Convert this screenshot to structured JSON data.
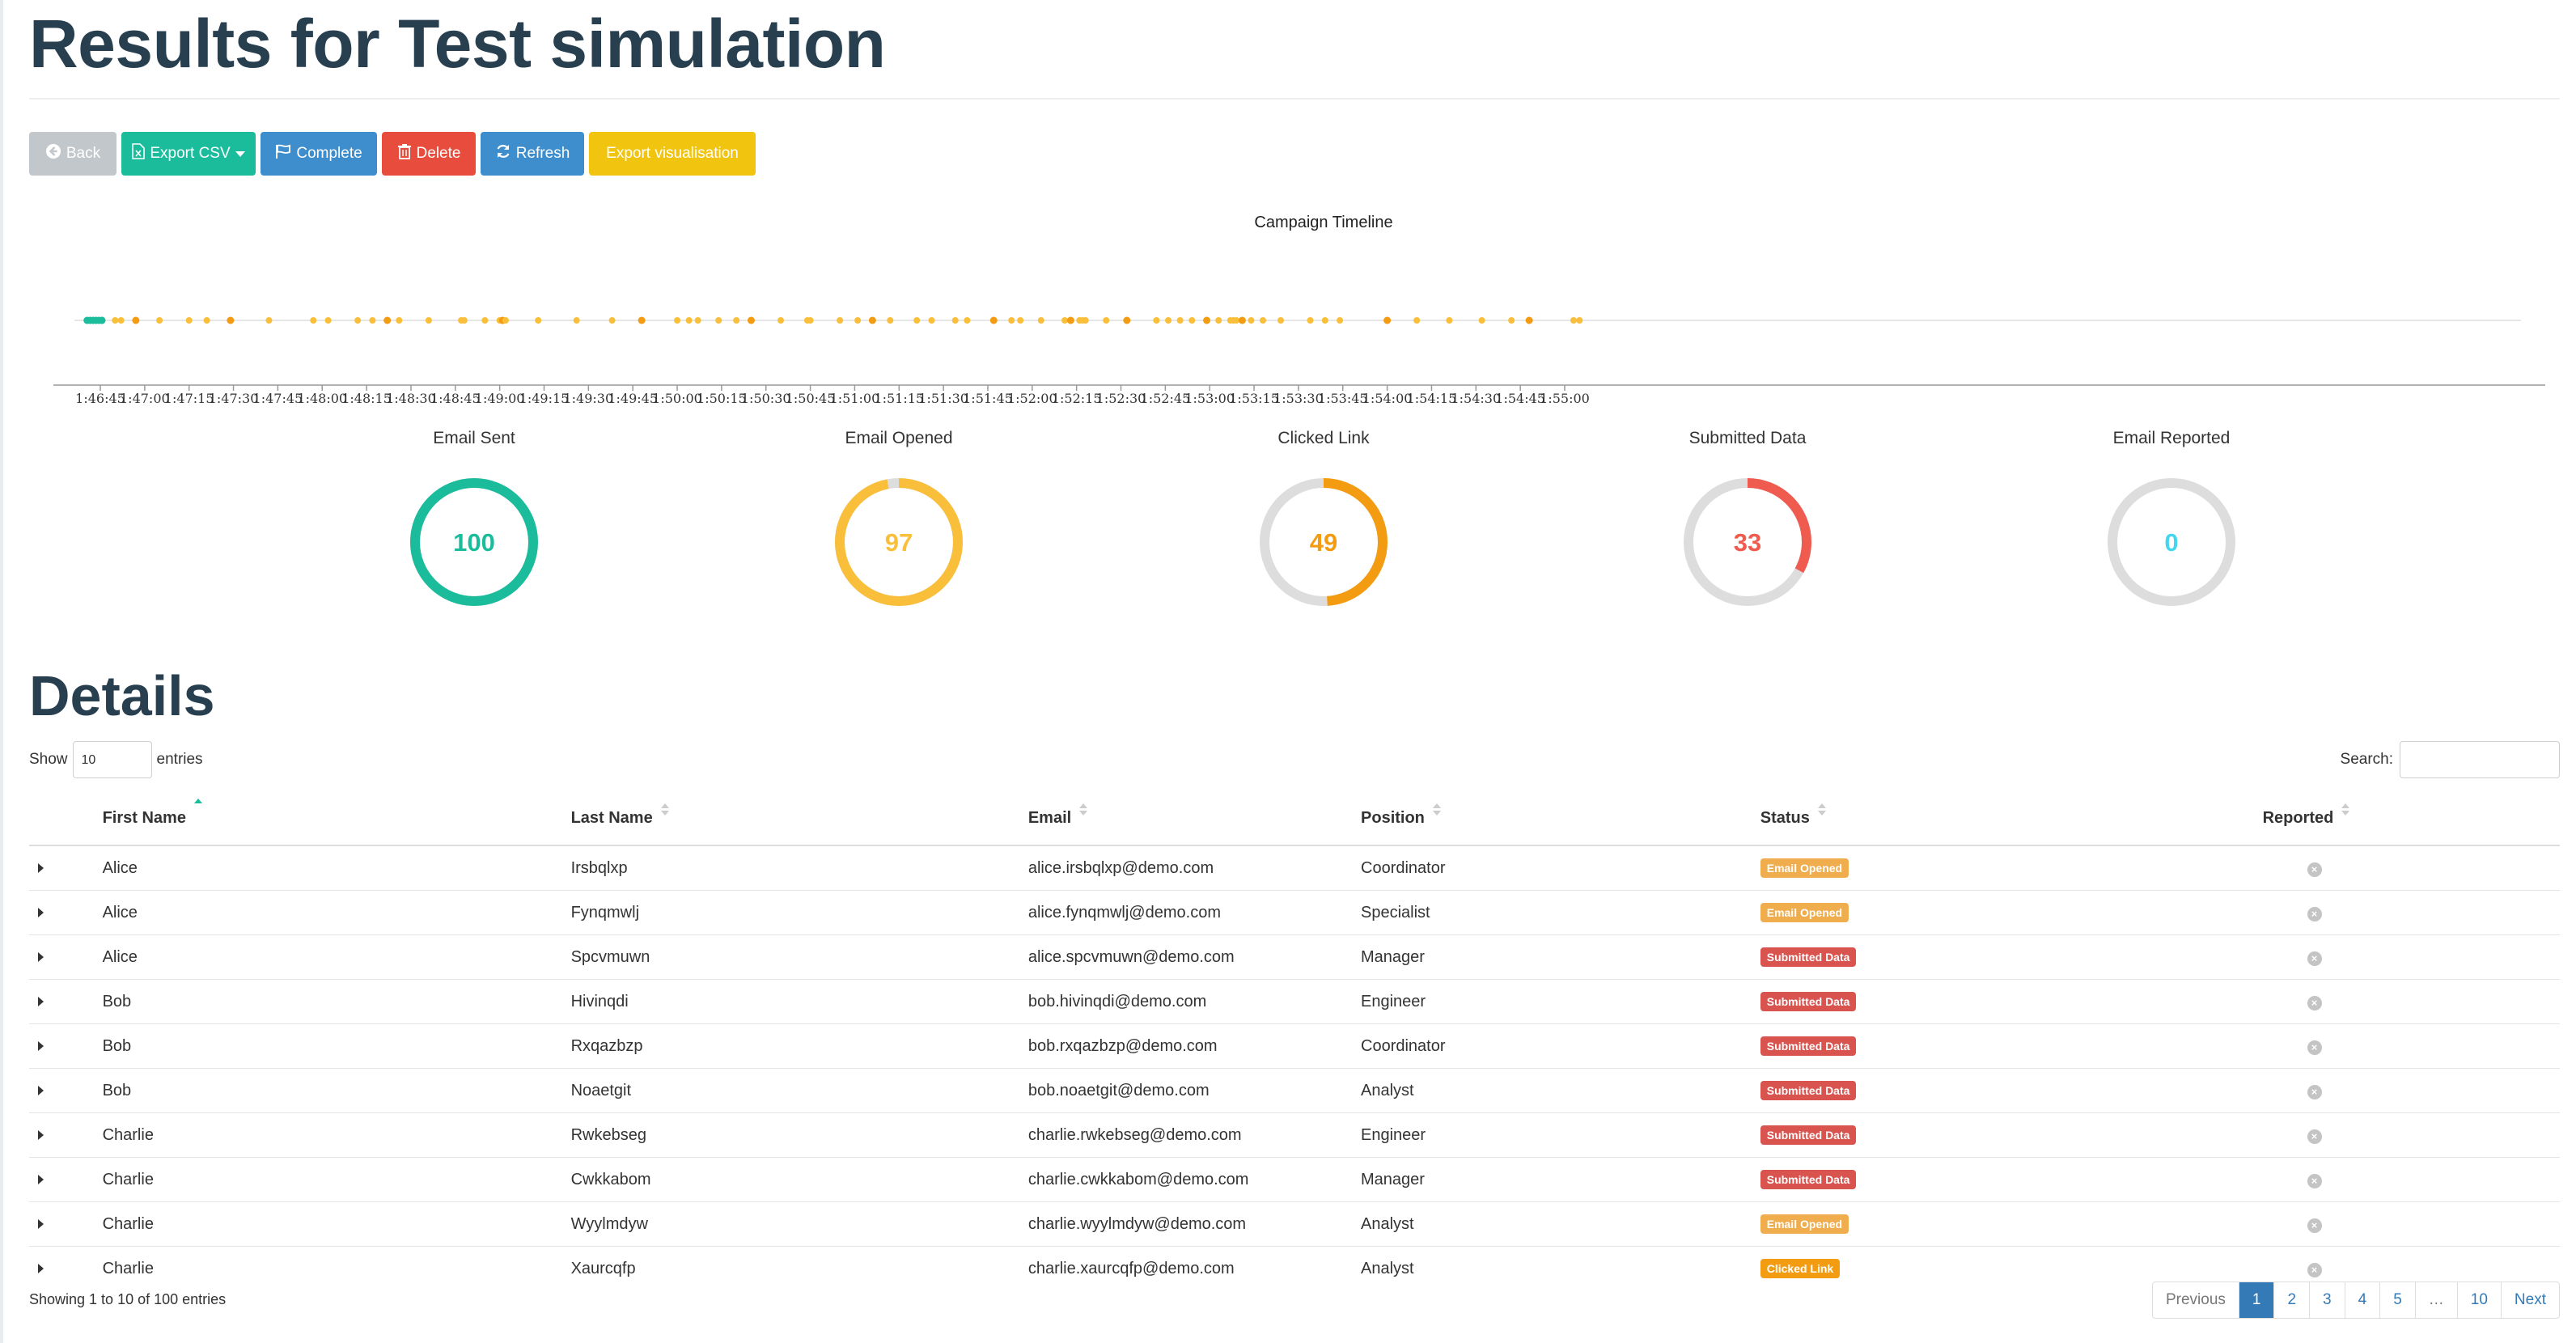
{
  "title": "Results for Test simulation",
  "toolbar": {
    "back": "Back",
    "export_csv": "Export CSV",
    "complete": "Complete",
    "delete": "Delete",
    "refresh": "Refresh",
    "export_visualisation": "Export visualisation"
  },
  "timeline": {
    "title": "Campaign Timeline",
    "ticks": [
      "1:46:45",
      "1:47:00",
      "1:47:15",
      "1:47:30",
      "1:47:45",
      "1:48:00",
      "1:48:15",
      "1:48:30",
      "1:48:45",
      "1:49:00",
      "1:49:15",
      "1:49:30",
      "1:49:45",
      "1:50:00",
      "1:50:15",
      "1:50:30",
      "1:50:45",
      "1:51:00",
      "1:51:15",
      "1:51:30",
      "1:51:45",
      "1:52:00",
      "1:52:15",
      "1:52:30",
      "1:52:45",
      "1:53:00",
      "1:53:15",
      "1:53:30",
      "1:53:45",
      "1:54:00",
      "1:54:15",
      "1:54:30",
      "1:54:45",
      "1:55:00"
    ],
    "sent_color": "#1abc9c",
    "opened_color": "#f9bf3b",
    "clicked_color": "#f39c12",
    "sent_times": [
      "1:46:40",
      "1:46:41",
      "1:46:42",
      "1:46:43",
      "1:46:44",
      "1:46:45"
    ],
    "event_times": [
      "1:46:50",
      "1:46:52",
      "1:46:57",
      "1:47:05",
      "1:47:15",
      "1:47:21",
      "1:47:29",
      "1:47:42",
      "1:47:57",
      "1:48:02",
      "1:48:12",
      "1:48:17",
      "1:48:22",
      "1:48:26",
      "1:48:36",
      "1:48:47",
      "1:48:48",
      "1:48:55",
      "1:49:00",
      "1:49:01",
      "1:49:02",
      "1:49:13",
      "1:49:26",
      "1:49:38",
      "1:49:48",
      "1:50:00",
      "1:50:04",
      "1:50:07",
      "1:50:14",
      "1:50:20",
      "1:50:25",
      "1:50:35",
      "1:50:44",
      "1:50:45",
      "1:50:55",
      "1:51:01",
      "1:51:06",
      "1:51:12",
      "1:51:21",
      "1:51:26",
      "1:51:34",
      "1:51:38",
      "1:51:47",
      "1:51:53",
      "1:51:56",
      "1:52:03",
      "1:52:11",
      "1:52:13",
      "1:52:16",
      "1:52:17",
      "1:52:18",
      "1:52:25",
      "1:52:32",
      "1:52:42",
      "1:52:46",
      "1:52:50",
      "1:52:54",
      "1:52:59",
      "1:53:03",
      "1:53:07",
      "1:53:08",
      "1:53:09",
      "1:53:11",
      "1:53:14",
      "1:53:18",
      "1:53:24",
      "1:53:34",
      "1:53:39",
      "1:53:44",
      "1:54:00",
      "1:54:10",
      "1:54:21",
      "1:54:32",
      "1:54:42",
      "1:54:48",
      "1:55:03",
      "1:55:05"
    ],
    "clicked_indices": [
      2,
      6,
      12,
      19,
      24,
      30,
      36,
      42,
      47,
      52,
      57,
      62,
      69,
      74
    ]
  },
  "stats": [
    {
      "label": "Email Sent",
      "value": "100",
      "percent": 100,
      "color": "#1abc9c"
    },
    {
      "label": "Email Opened",
      "value": "97",
      "percent": 97,
      "color": "#f9bf3b"
    },
    {
      "label": "Clicked Link",
      "value": "49",
      "percent": 49,
      "color": "#f39c12"
    },
    {
      "label": "Submitted Data",
      "value": "33",
      "percent": 33,
      "color": "#f05b4f"
    },
    {
      "label": "Email Reported",
      "value": "0",
      "percent": 0,
      "color": "#45d6ef"
    }
  ],
  "details": {
    "title": "Details",
    "show_label": "Show",
    "entries_label": "entries",
    "length_value": "10",
    "search_label": "Search:",
    "columns": [
      "First Name",
      "Last Name",
      "Email",
      "Position",
      "Status",
      "Reported"
    ],
    "rows": [
      {
        "first": "Alice",
        "last": "Irsbqlxp",
        "email": "alice.irsbqlxp@demo.com",
        "position": "Coordinator",
        "status": "Email Opened",
        "status_type": "opened"
      },
      {
        "first": "Alice",
        "last": "Fynqmwlj",
        "email": "alice.fynqmwlj@demo.com",
        "position": "Specialist",
        "status": "Email Opened",
        "status_type": "opened"
      },
      {
        "first": "Alice",
        "last": "Spcvmuwn",
        "email": "alice.spcvmuwn@demo.com",
        "position": "Manager",
        "status": "Submitted Data",
        "status_type": "submitted"
      },
      {
        "first": "Bob",
        "last": "Hivinqdi",
        "email": "bob.hivinqdi@demo.com",
        "position": "Engineer",
        "status": "Submitted Data",
        "status_type": "submitted"
      },
      {
        "first": "Bob",
        "last": "Rxqazbzp",
        "email": "bob.rxqazbzp@demo.com",
        "position": "Coordinator",
        "status": "Submitted Data",
        "status_type": "submitted"
      },
      {
        "first": "Bob",
        "last": "Noaetgit",
        "email": "bob.noaetgit@demo.com",
        "position": "Analyst",
        "status": "Submitted Data",
        "status_type": "submitted"
      },
      {
        "first": "Charlie",
        "last": "Rwkebseg",
        "email": "charlie.rwkebseg@demo.com",
        "position": "Engineer",
        "status": "Submitted Data",
        "status_type": "submitted"
      },
      {
        "first": "Charlie",
        "last": "Cwkkabom",
        "email": "charlie.cwkkabom@demo.com",
        "position": "Manager",
        "status": "Submitted Data",
        "status_type": "submitted"
      },
      {
        "first": "Charlie",
        "last": "Wyylmdyw",
        "email": "charlie.wyylmdyw@demo.com",
        "position": "Analyst",
        "status": "Email Opened",
        "status_type": "opened"
      },
      {
        "first": "Charlie",
        "last": "Xaurcqfp",
        "email": "charlie.xaurcqfp@demo.com",
        "position": "Analyst",
        "status": "Clicked Link",
        "status_type": "clicked"
      }
    ],
    "info": "Showing 1 to 10 of 100 entries",
    "pagination": {
      "previous": "Previous",
      "next": "Next",
      "pages": [
        "1",
        "2",
        "3",
        "4",
        "5",
        "…",
        "10"
      ],
      "active": "1"
    }
  }
}
